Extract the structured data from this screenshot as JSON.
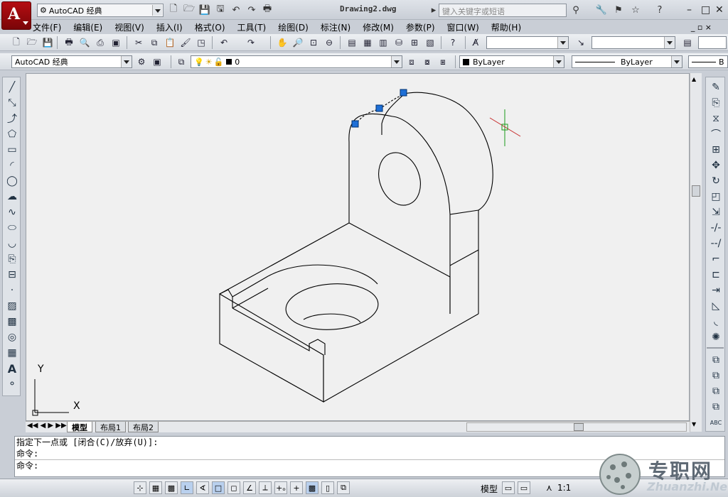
{
  "window": {
    "app_letter": "A",
    "workspace": "AutoCAD 经典",
    "doc_title": "Drawing2.dwg",
    "search_placeholder": "键入关键字或短语"
  },
  "menu": [
    "文件(F)",
    "编辑(E)",
    "视图(V)",
    "插入(I)",
    "格式(O)",
    "工具(T)",
    "绘图(D)",
    "标注(N)",
    "修改(M)",
    "参数(P)",
    "窗口(W)",
    "帮助(H)"
  ],
  "properties_bar": {
    "workspace_combo": "AutoCAD 经典",
    "layer_value": "0",
    "color_value": "ByLayer",
    "linetype_value": "ByLayer",
    "lineweight_value": "B"
  },
  "layout_tabs": [
    "模型",
    "布局1",
    "布局2"
  ],
  "ucs": {
    "y_label": "Y",
    "x_label": "X"
  },
  "command": {
    "line1": "指定下一点或 [闭合(C)/放弃(U)]:",
    "line2": "命令:",
    "line3": "命令:"
  },
  "status": {
    "model_label": "模型",
    "scale_label": "1:1"
  },
  "watermark": {
    "brand": "专职网",
    "site": "Zhuanzhi.Net"
  },
  "colors": {
    "canvas": "#f0f0f0",
    "grip": "#1e6fd6",
    "crosshair_green": "#1a9a1a",
    "crosshair_red": "#c62828"
  }
}
